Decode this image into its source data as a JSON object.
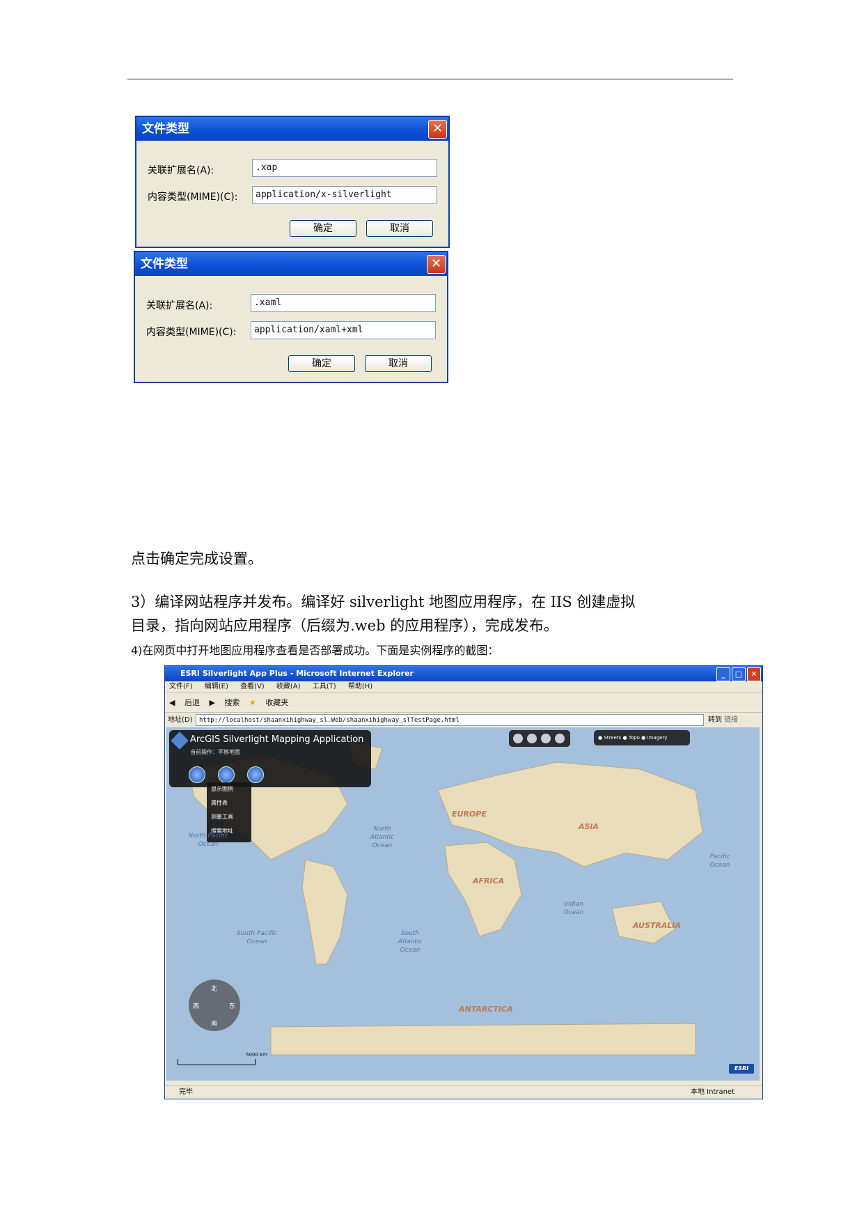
{
  "dialog1": {
    "title": "文件类型",
    "ext_label": "关联扩展名(A):",
    "ext_value": ".xap",
    "mime_label": "内容类型(MIME)(C):",
    "mime_value": "application/x-silverlight",
    "ok": "确定",
    "cancel": "取消"
  },
  "dialog2": {
    "title": "文件类型",
    "ext_label": "关联扩展名(A):",
    "ext_value": ".xaml",
    "mime_label": "内容类型(MIME)(C):",
    "mime_value": "application/xaml+xml",
    "ok": "确定",
    "cancel": "取消"
  },
  "text": {
    "p1": "点击确定完成设置。",
    "p2_line1": "3）编译网站程序并发布。编译好 silverlight 地图应用程序，在 IIS 创建虚拟",
    "p2_line2": "目录，指向网站应用程序（后缀为.web 的应用程序），完成发布。",
    "p3": "4)在网页中打开地图应用程序查看是否部署成功。下面是实例程序的截图："
  },
  "browser": {
    "title": "ESRI Silverlight App Plus - Microsoft Internet Explorer",
    "menu": [
      "文件(F)",
      "编辑(E)",
      "查看(V)",
      "收藏(A)",
      "工具(T)",
      "帮助(H)"
    ],
    "tools": [
      "后退",
      "搜索",
      "收藏夹"
    ],
    "address_label": "地址(D)",
    "url": "http://localhost/shaanxihighway_sl.Web/shaanxihighway_slTestPage.html",
    "go": "转到",
    "links": "链接",
    "status_left": "完毕",
    "status_right": "本地 Intranet"
  },
  "app": {
    "title": "ArcGIS Silverlight Mapping Application",
    "subtitle": "当前操作：平移地图",
    "menu_items": [
      "显示图例",
      "属性表",
      "测量工具",
      "搜索地址"
    ],
    "basemaps": [
      "Streets",
      "Topo",
      "Imagery"
    ],
    "map_labels": [
      "EUROPE",
      "ASIA",
      "AFRICA",
      "AUSTRALIA",
      "ANTARCTICA"
    ],
    "oceans": [
      "North Pacific Ocean",
      "North Atlantic Ocean",
      "Pacific Ocean",
      "Indian Ocean",
      "South Pacific Ocean",
      "South Atlantic Ocean"
    ],
    "compass": {
      "n": "北",
      "s": "南",
      "w": "西",
      "e": "东"
    },
    "scale": "5000 km",
    "logo": "ESRI"
  }
}
